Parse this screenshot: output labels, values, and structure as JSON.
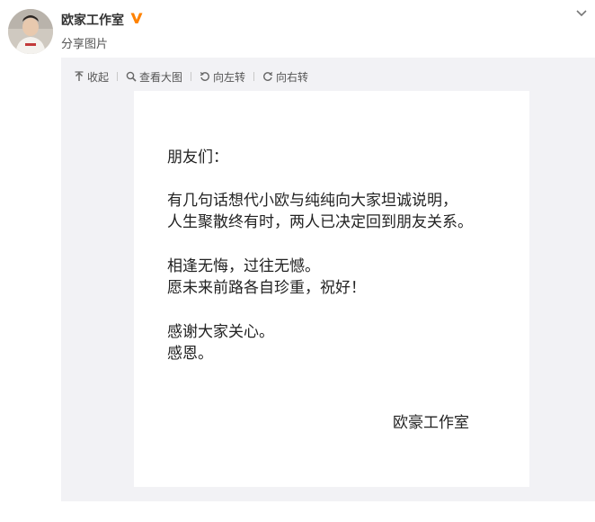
{
  "post": {
    "author_name": "欧家工作室",
    "subtitle": "分享图片"
  },
  "toolbar": {
    "collapse_label": "收起",
    "view_large_label": "查看大图",
    "rotate_left_label": "向左转",
    "rotate_right_label": "向右转"
  },
  "letter": {
    "greeting": "朋友们：",
    "para1_line1": "有几句话想代小欧与纯纯向大家坦诚说明，",
    "para1_line2": "人生聚散终有时，两人已决定回到朋友关系。",
    "para2_line1": "相逢无悔，过往无憾。",
    "para2_line2": "愿未来前路各自珍重，祝好！",
    "para3_line1": "感谢大家关心。",
    "para3_line2": "感恩。",
    "signature": "欧豪工作室"
  },
  "colors": {
    "verified_badge": "#ff8200",
    "panel_background": "#f2f2f5",
    "text": "#222222"
  }
}
